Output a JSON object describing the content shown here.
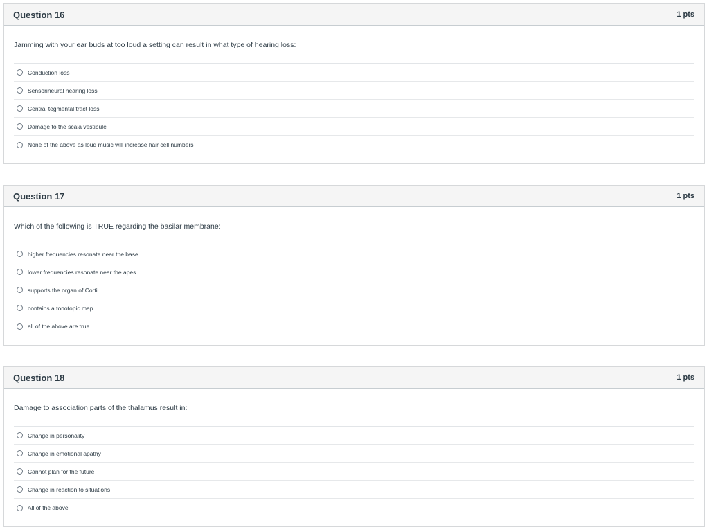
{
  "questions": [
    {
      "title": "Question 16",
      "points": "1 pts",
      "prompt": "Jamming with your ear buds at too loud a setting can result in what type of hearing loss:",
      "answers": [
        "Conduction loss",
        "Sensorineural hearing loss",
        "Central tegmental tract loss",
        "Damage to the scala vestibule",
        "None of the above as loud music will increase hair cell numbers"
      ]
    },
    {
      "title": "Question 17",
      "points": "1 pts",
      "prompt": "Which of the following is TRUE regarding the basilar membrane:",
      "answers": [
        "higher frequencies resonate near the base",
        "lower frequencies resonate near the apes",
        "supports the organ of Corti",
        "contains a tonotopic map",
        "all of the above are true"
      ]
    },
    {
      "title": "Question 18",
      "points": "1 pts",
      "prompt": "Damage to association parts of the thalamus result in:",
      "answers": [
        "Change in personality",
        "Change in emotional apathy",
        "Cannot plan for the future",
        "Change in reaction to situations",
        "All of the above"
      ]
    }
  ]
}
